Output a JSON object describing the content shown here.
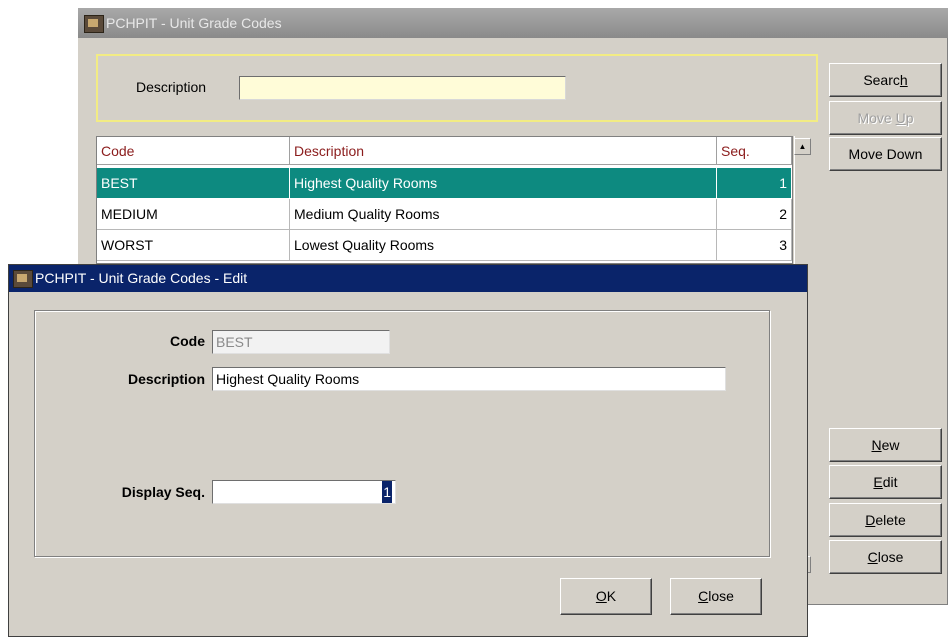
{
  "main_window": {
    "title": "PCHPIT - Unit Grade Codes",
    "search": {
      "description_label": "Description",
      "description_value": ""
    },
    "grid": {
      "headers": [
        "Code",
        "Description",
        "Seq."
      ],
      "rows": [
        {
          "code": "BEST",
          "description": "Highest Quality Rooms",
          "seq": "1",
          "selected": true
        },
        {
          "code": "MEDIUM",
          "description": "Medium Quality Rooms",
          "seq": "2",
          "selected": false
        },
        {
          "code": "WORST",
          "description": "Lowest Quality Rooms",
          "seq": "3",
          "selected": false
        }
      ]
    },
    "buttons": {
      "search": {
        "pre": "Searc",
        "key": "h",
        "post": ""
      },
      "move_up": {
        "pre": "Move ",
        "key": "U",
        "post": "p"
      },
      "move_down": {
        "pre": "Move Down",
        "key": "",
        "post": ""
      },
      "new": {
        "pre": "",
        "key": "N",
        "post": "ew"
      },
      "edit": {
        "pre": "",
        "key": "E",
        "post": "dit"
      },
      "delete": {
        "pre": "",
        "key": "D",
        "post": "elete"
      },
      "close": {
        "pre": "",
        "key": "C",
        "post": "lose"
      }
    }
  },
  "edit_dialog": {
    "title": "PCHPIT - Unit Grade Codes - Edit",
    "code_label": "Code",
    "code_value": "BEST",
    "description_label": "Description",
    "description_value": "Highest Quality Rooms",
    "display_seq_label": "Display Seq.",
    "display_seq_value": "1",
    "ok_button": {
      "pre": "",
      "key": "O",
      "post": "K"
    },
    "close_button": {
      "pre": "",
      "key": "C",
      "post": "lose"
    }
  },
  "colors": {
    "selected_row": "#0d8a80",
    "dialog_titlebar": "#0a246a",
    "inactive_titlebar": "#999999",
    "search_panel_border": "#f2ec84",
    "header_text": "#8b1c1c"
  }
}
